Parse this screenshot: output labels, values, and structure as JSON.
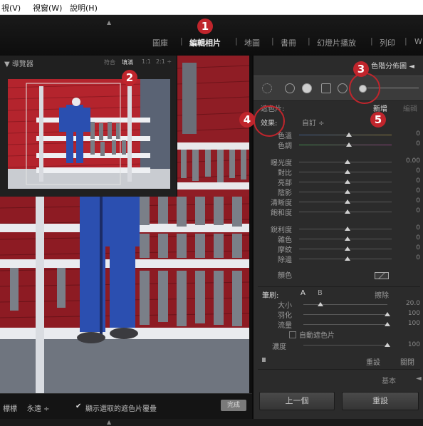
{
  "menu": {
    "items": [
      "視(V)",
      "視窗(W)",
      "說明(H)"
    ]
  },
  "modules": {
    "items": [
      "圖庫",
      "編輯相片",
      "地圖",
      "書冊",
      "幻燈片播放",
      "列印",
      "W"
    ],
    "active_index": 1,
    "separator": "|"
  },
  "navigator": {
    "title": "▼ 導覽器",
    "zoom_options": [
      "符合",
      "填滿",
      "1:1",
      "2:1 ÷"
    ],
    "active_zoom": "填滿"
  },
  "toolbar": {
    "label": "標標",
    "dropdown": "永遠 ÷",
    "checkbox_checked": true,
    "checkbox_label": "顯示選取的遮色片覆疊",
    "done_button": "完成"
  },
  "right_panel": {
    "header": "色階分佈圖",
    "header_arrow": "◄",
    "mask_row": {
      "label": "遮色片:",
      "new": "新增",
      "edit": "編輯"
    },
    "effect_row": {
      "label": "效果:",
      "value": "自訂 ÷"
    },
    "groups": [
      {
        "label": "色溫",
        "value": "0"
      },
      {
        "label": "色調",
        "value": "0"
      },
      {
        "label": "曝光度",
        "value": "0.00"
      },
      {
        "label": "對比",
        "value": "0"
      },
      {
        "label": "亮部",
        "value": "0"
      },
      {
        "label": "陰影",
        "value": "0"
      },
      {
        "label": "清晰度",
        "value": "0"
      },
      {
        "label": "飽和度",
        "value": "0"
      },
      {
        "label": "銳利度",
        "value": "0"
      },
      {
        "label": "雜色",
        "value": "0"
      },
      {
        "label": "摩紋",
        "value": "0"
      },
      {
        "label": "除邊",
        "value": "0"
      }
    ],
    "color_label": "顏色",
    "brush": {
      "label": "筆刷:",
      "a": "A",
      "b": "B",
      "erase": "擦除"
    },
    "brush_settings": [
      {
        "label": "大小",
        "value": "20.0"
      },
      {
        "label": "羽化",
        "value": "100"
      },
      {
        "label": "流量",
        "value": "100"
      }
    ],
    "auto_mask": "自動遮色片",
    "density": {
      "label": "濃度",
      "value": "100"
    },
    "reset": "重設",
    "close": "關閉",
    "basic": "基本",
    "basic_arrow": "◄",
    "prev_button": "上一個",
    "reset_button": "重設"
  },
  "callouts": [
    "1",
    "2",
    "3",
    "4",
    "5"
  ],
  "colors": {
    "accent": "#c0252c",
    "panel": "#2b2b2b",
    "wall_red": "#b8252e",
    "suit_blue": "#2a4fb0"
  }
}
